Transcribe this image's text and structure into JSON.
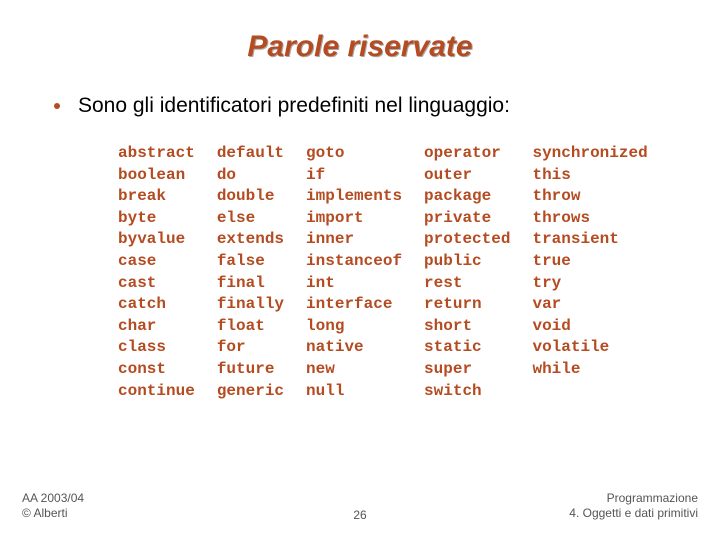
{
  "title": "Parole riservate",
  "bullet": "Sono gli identificatori predefiniti nel linguaggio:",
  "columns": [
    [
      "abstract",
      "boolean",
      "break",
      "byte",
      "byvalue",
      "case",
      "cast",
      "catch",
      "char",
      "class",
      "const",
      "continue"
    ],
    [
      "default",
      "do",
      "double",
      "else",
      "extends",
      "false",
      "final",
      "finally",
      "float",
      "for",
      "future",
      "generic"
    ],
    [
      "goto",
      "if",
      "implements",
      "import",
      "inner",
      "instanceof",
      "int",
      "interface",
      "long",
      "native",
      "new",
      "null"
    ],
    [
      "operator",
      "outer",
      "package",
      "private",
      "protected",
      "public",
      "rest",
      "return",
      "short",
      "static",
      "super",
      "switch"
    ],
    [
      "synchronized",
      "this",
      "throw",
      "throws",
      "transient",
      "true",
      "try",
      "var",
      "void",
      "volatile",
      "while"
    ]
  ],
  "footer": {
    "left_line1": "AA 2003/04",
    "left_line2": "© Alberti",
    "page": "26",
    "right_line1": "Programmazione",
    "right_line2": "4. Oggetti e dati primitivi"
  }
}
